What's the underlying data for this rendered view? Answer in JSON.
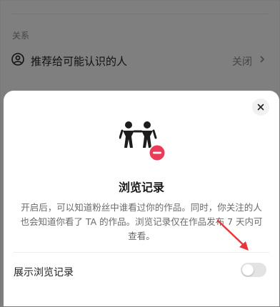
{
  "background": {
    "section_label": "关系",
    "row": {
      "label": "推荐给可能认识的人",
      "value": "关闭",
      "icon": "user-circle-icon"
    }
  },
  "sheet": {
    "title": "浏览记录",
    "description": "开启后，可以知道粉丝中谁看过你的作品。同时，你关注的人也会知道你看了 TA 的作品。浏览记录仅在作品发布 7 天内可查看。",
    "toggle_label": "展示浏览记录",
    "toggle_on": false,
    "icons": {
      "close": "close-icon",
      "hero": "view-history-icon"
    }
  },
  "colors": {
    "overlay": "rgba(0,0,0,0.5)",
    "badge_red": "#ea3c58",
    "arrow_red": "#e8343a",
    "toggle_off": "#e3e3e3"
  }
}
